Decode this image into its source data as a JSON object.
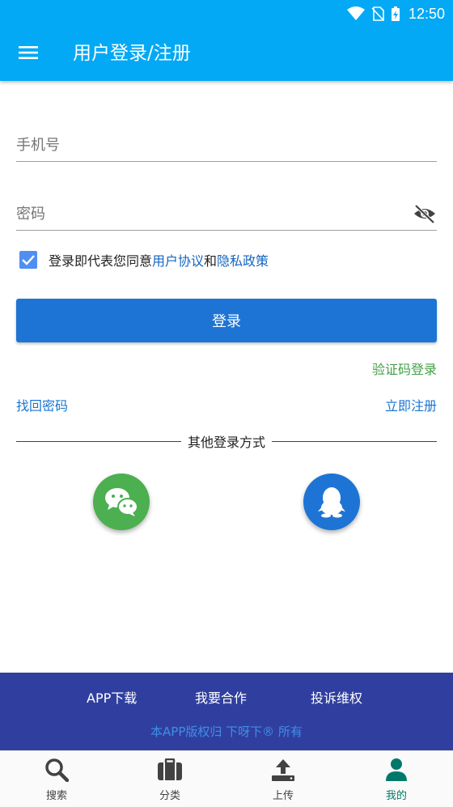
{
  "statusbar": {
    "time": "12:50"
  },
  "appbar": {
    "title": "用户登录/注册"
  },
  "form": {
    "phone_placeholder": "手机号",
    "password_placeholder": "密码",
    "agree_prefix": "登录即代表您同意",
    "agree_link1": "用户协议",
    "agree_and": "和",
    "agree_link2": "隐私政策",
    "login_label": "登录",
    "sms_login": "验证码登录",
    "forgot_password": "找回密码",
    "register_now": "立即注册",
    "other_methods": "其他登录方式"
  },
  "social": {
    "wechat_icon": "wechat-icon",
    "qq_icon": "qq-icon"
  },
  "footer": {
    "links": [
      "APP下载",
      "我要合作",
      "投诉维权"
    ],
    "copyright": "本APP版权归 下呀下® 所有"
  },
  "bottomnav": {
    "items": [
      {
        "label": "搜索",
        "icon": "search-icon"
      },
      {
        "label": "分类",
        "icon": "briefcase-icon"
      },
      {
        "label": "上传",
        "icon": "upload-icon"
      },
      {
        "label": "我的",
        "icon": "user-icon"
      }
    ]
  },
  "colors": {
    "appbar": "#03a9f4",
    "primary_button": "#1e74d4",
    "link": "#1976d2",
    "sms_link": "#43a047",
    "footer": "#303f9f",
    "wechat": "#4caf50",
    "qq": "#1e74d4"
  }
}
